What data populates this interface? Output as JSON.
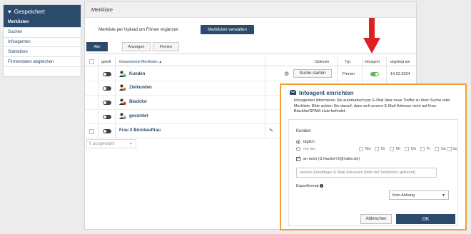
{
  "sidebar": {
    "title": "Gespeichert",
    "items": [
      {
        "label": "Merklisten",
        "active": true
      },
      {
        "label": "Suchen",
        "active": false
      },
      {
        "label": "Infoagenten",
        "active": false
      },
      {
        "label": "Statistiken",
        "active": false
      },
      {
        "label": "Firmendaten abgleichen",
        "active": false
      }
    ]
  },
  "main": {
    "title": "Merkliste",
    "upload_label": "Merkliste per Upload um Firmen ergänzen",
    "manage_button": "Merklisten verwalten",
    "tabs": [
      {
        "label": "Alle",
        "active": true
      },
      {
        "label": "Anzeigen",
        "active": false
      },
      {
        "label": "Firmen",
        "active": false
      }
    ],
    "columns": {
      "geteilt": "geteilt",
      "name": "Gespeicherte Merklisten ▲",
      "optionen": "Optionen",
      "typ": "Typ",
      "infoagent": "Infoagent",
      "angelegt": "angelegt am"
    },
    "rows": [
      {
        "name": "Kunden",
        "button": "Suche starten",
        "typ": "Firmen",
        "date": "14.02.2024",
        "has_checkbox": false
      },
      {
        "name": "Zielkunden",
        "has_checkbox": false
      },
      {
        "name": "Blacklist",
        "has_checkbox": false
      },
      {
        "name": "gesichtet",
        "has_checkbox": false
      },
      {
        "name": "Frau X Bürokauffrau",
        "has_checkbox": true
      }
    ],
    "selected_label": "0 ausgewählt"
  },
  "modal": {
    "title": "Infoagent einrichten",
    "description": "Infoagenten informieren Sie automatisch per E-Mail über neue Treffer zu Ihrer Suche oder Merkliste. Bitte achten Sie darauf, dass sich unsere E-Mail-Adresse nicht auf Ihrer Blacklist/SPAM-Liste befindet.",
    "section_label": "Kunden",
    "option_daily": "täglich",
    "option_on": "nur am",
    "days": [
      "Mo",
      "Di",
      "Mi",
      "Do",
      "Fr",
      "Sa",
      "So"
    ],
    "email_me": "an mich (S.Hackel+2@index.de)",
    "email_placeholder": "weitere Empfänger-E-Mail-Adressen (bitte mit Semikolon getrennt)",
    "export_label": "Exportformat",
    "export_value": "Kein Anhang",
    "cancel": "Abbrechen",
    "ok": "OK"
  },
  "colors": {
    "brand": "#2c4a6b",
    "highlight": "#f0a030",
    "arrow": "#e02020",
    "toggle_on": "#5cb85c"
  }
}
